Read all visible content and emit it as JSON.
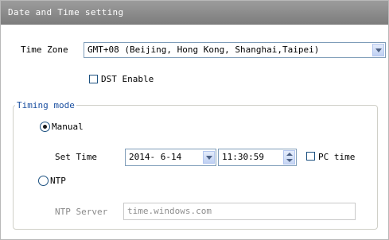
{
  "panel": {
    "title": "Date and Time setting"
  },
  "timezone": {
    "label": "Time Zone",
    "value": "GMT+08 (Beijing, Hong Kong, Shanghai,Taipei)"
  },
  "dst": {
    "label": "DST Enable",
    "checked": false
  },
  "timing": {
    "legend": "Timing mode",
    "manual": {
      "label": "Manual",
      "checked": true
    },
    "set_time": {
      "label": "Set Time",
      "date": "2014- 6-14",
      "time": "11:30:59",
      "pc_time_label": "PC time",
      "pc_time_checked": false
    },
    "ntp": {
      "label": "NTP",
      "checked": false
    },
    "ntp_server": {
      "label": "NTP Server",
      "value": "time.windows.com",
      "disabled": true
    }
  },
  "colors": {
    "titlebar": "#8c8c8c",
    "legend": "#1a4fa0",
    "input_border": "#7f9db9"
  }
}
